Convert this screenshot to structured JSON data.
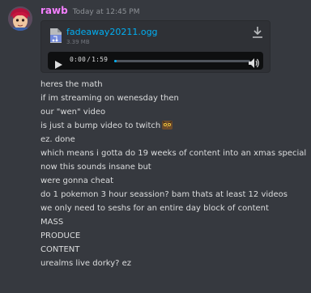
{
  "message": {
    "username": "rawb",
    "timestamp": "Today at 12:45 PM",
    "username_color": "#f47fff"
  },
  "attachment": {
    "file_name": "fadeaway20211.ogg",
    "file_size": "3.39 MB",
    "file_icon": "audio-file-icon",
    "download_icon": "download-icon",
    "player": {
      "current_time": "0:00",
      "separator": "/",
      "duration": "1:59",
      "progress_fraction": 0.0,
      "play_icon": "play-icon",
      "volume_icon": "volume-icon"
    }
  },
  "lines": [
    "heres the math",
    "if im streaming on wenesday then",
    "our \"wen\" video",
    "is just a bump video to twitch",
    "ez. done",
    "which means i gotta do 19 weeks of content into an xmas special",
    "now this sounds insane but",
    "were gonna cheat",
    "do 1 pokemon 3 hour seassion? bam thats at least 12 videos",
    "we only need to seshs for an entire day block of content",
    "MASS",
    "PRODUCE",
    "CONTENT",
    "urealms live dorky? ez"
  ],
  "emoji": "owl-emoji",
  "accent_color": "#00b0f4"
}
